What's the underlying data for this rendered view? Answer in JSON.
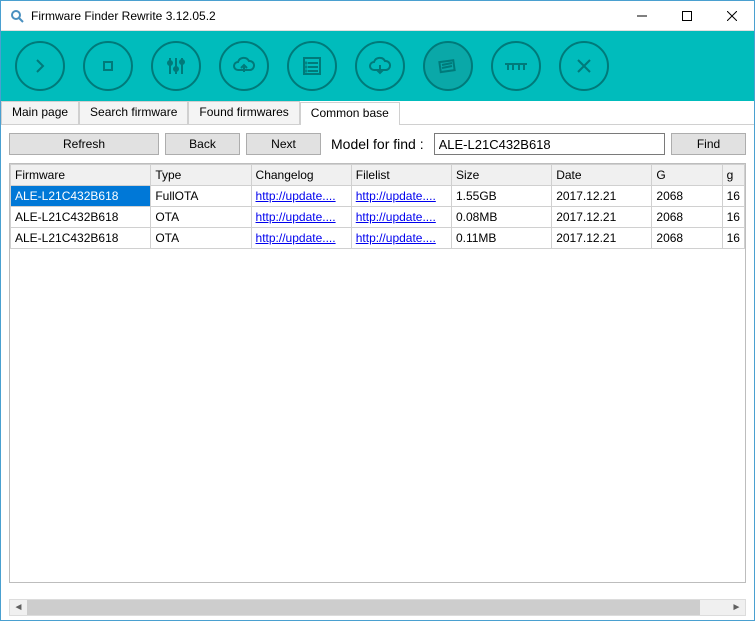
{
  "window": {
    "title": "Firmware Finder Rewrite 3.12.05.2"
  },
  "tabs": {
    "t0": "Main page",
    "t1": "Search firmware",
    "t2": "Found firmwares",
    "t3": "Common base"
  },
  "controls": {
    "refresh": "Refresh",
    "back": "Back",
    "next": "Next",
    "model_label": "Model for find :",
    "model_value": "ALE-L21C432B618",
    "find": "Find"
  },
  "columns": {
    "c0": "Firmware",
    "c1": "Type",
    "c2": "Changelog",
    "c3": "Filelist",
    "c4": "Size",
    "c5": "Date",
    "c6": "G",
    "c7": "g"
  },
  "rows": {
    "r0": {
      "firmware": "ALE-L21C432B618",
      "type": "FullOTA",
      "changelog": "http://update....",
      "filelist": "http://update....",
      "size": "1.55GB",
      "date": "2017.12.21",
      "g1": "2068",
      "g2": "16"
    },
    "r1": {
      "firmware": "ALE-L21C432B618",
      "type": "OTA",
      "changelog": "http://update....",
      "filelist": "http://update....",
      "size": "0.08MB",
      "date": "2017.12.21",
      "g1": "2068",
      "g2": "16"
    },
    "r2": {
      "firmware": "ALE-L21C432B618",
      "type": "OTA",
      "changelog": "http://update....",
      "filelist": "http://update....",
      "size": "0.11MB",
      "date": "2017.12.21",
      "g1": "2068",
      "g2": "16"
    }
  }
}
